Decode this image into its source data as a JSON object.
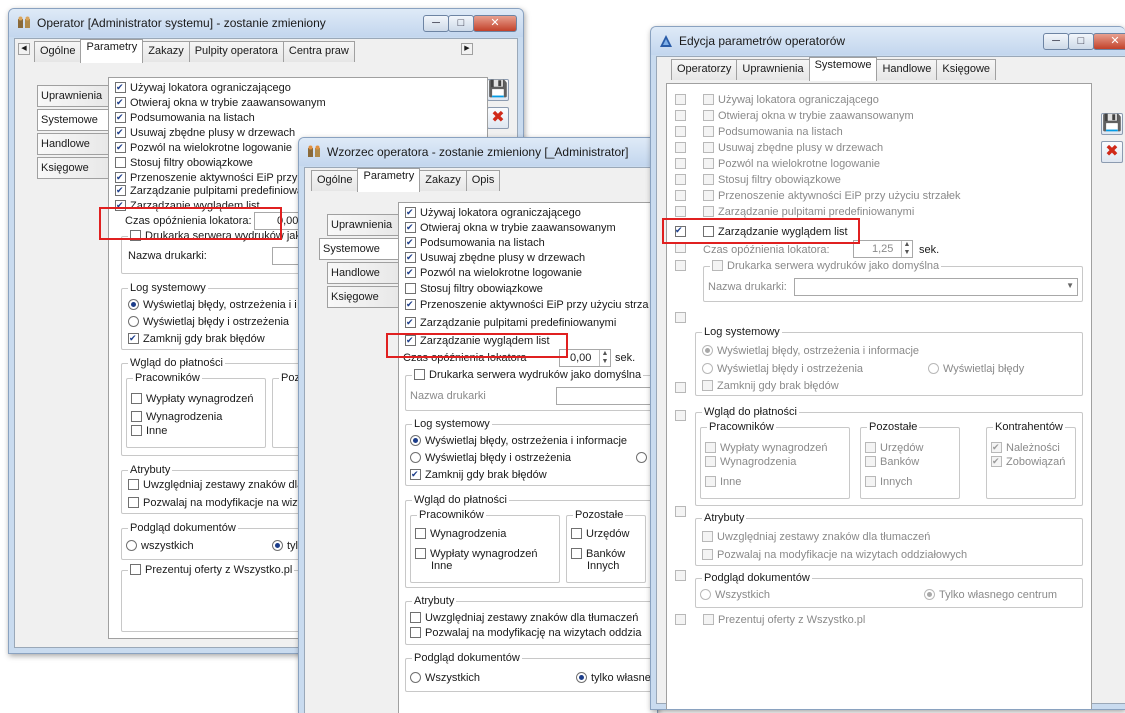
{
  "colors": {
    "highlight": "#e02020",
    "title_gradient_top": "#dfeaf7",
    "checkbox_mark": "#1c3d8a"
  },
  "win1": {
    "title": "Operator [Administrator systemu] - zostanie zmieniony",
    "tabs": [
      "Ogólne",
      "Parametry",
      "Zakazy",
      "Pulpity operatora",
      "Centra praw"
    ],
    "vtabs": [
      "Uprawnienia",
      "Systemowe",
      "Handlowe",
      "Księgowe"
    ],
    "checks": [
      "Używaj lokatora ograniczającego",
      "Otwieraj okna w trybie zaawansowanym",
      "Podsumowania na listach",
      "Usuwaj zbędne plusy w drzewach",
      "Pozwól na wielokrotne logowanie",
      "Stosuj filtry obowiązkowe",
      "Przenoszenie aktywności EiP przy",
      "Zarządzanie pulpitami predefiniowanymi",
      "Zarządzanie wyglądem list"
    ],
    "lokator_label": "Czas opóźnienia lokatora:",
    "lokator_value": "0,00",
    "printer_check": "Drukarka serwera wydruków jako",
    "printer_label": "Nazwa drukarki:",
    "log_group": "Log systemowy",
    "log_opts": [
      "Wyświetlaj błędy, ostrzeżenia i i",
      "Wyświetlaj błędy i ostrzeżenia"
    ],
    "log_close": "Zamknij gdy brak błędów",
    "wglad_group": "Wgląd do płatności",
    "pracownikow": "Pracowników",
    "pozo": "Pozo",
    "pracownikow_items": [
      "Wypłaty wynagrodzeń",
      "Wynagrodzenia",
      "Inne"
    ],
    "atrybuty_group": "Atrybuty",
    "atrybuty_items": [
      "Uwzględniaj zestawy znaków dla",
      "Pozwalaj na modyfikacje na wizy"
    ],
    "podglad_group": "Podgląd dokumentów",
    "podglad_opts": [
      "wszystkich",
      "tyll"
    ],
    "prezentuj": "Prezentuj oferty z Wszystko.pl"
  },
  "win2": {
    "title": "Wzorzec operatora - zostanie zmieniony [_Administrator]",
    "tabs": [
      "Ogólne",
      "Parametry",
      "Zakazy",
      "Opis"
    ],
    "vtabs": [
      "Uprawnienia",
      "Systemowe",
      "Handlowe",
      "Księgowe"
    ],
    "checks": [
      "Używaj lokatora ograniczającego",
      "Otwieraj okna w trybie zaawansowanym",
      "Podsumowania na listach",
      "Usuwaj zbędne plusy w drzewach",
      "Pozwól na wielokrotne logowanie",
      "Stosuj filtry obowiązkowe",
      "Przenoszenie aktywności EiP przy użyciu strza",
      "Zarządzanie pulpitami predefiniowanymi",
      "Zarządzanie wyglądem list"
    ],
    "lokator_label": "Czas opóźnienia lokatora",
    "lokator_value": "0,00",
    "lokator_unit": "sek.",
    "printer_check": "Drukarka serwera wydruków jako domyślna",
    "printer_label": "Nazwa drukarki",
    "log_group": "Log systemowy",
    "log_opts": [
      "Wyświetlaj błędy, ostrzeżenia i informacje",
      "Wyświetlaj błędy i ostrzeżenia",
      "Wy"
    ],
    "log_close": "Zamknij gdy brak błędów",
    "wglad_group": "Wgląd do płatności",
    "pracownikow": "Pracowników",
    "pozostale": "Pozostałe",
    "pracownikow_items": [
      "Wynagrodzenia",
      "Wypłaty wynagrodzeń",
      "Inne"
    ],
    "pozostale_items": [
      "Urzędów",
      "Banków",
      "Innych"
    ],
    "atrybuty_group": "Atrybuty",
    "atrybuty_items": [
      "Uwzględniaj zestawy znaków dla tłumaczeń",
      "Pozwalaj na modyfikację na wizytach oddzia"
    ],
    "podglad_group": "Podgląd dokumentów",
    "podglad_opts": [
      "Wszystkich",
      "tylko własne"
    ]
  },
  "win3": {
    "title": "Edycja parametrów operatorów",
    "tabs": [
      "Operatorzy",
      "Uprawnienia",
      "Systemowe",
      "Handlowe",
      "Księgowe"
    ],
    "checks": [
      "Używaj lokatora ograniczającego",
      "Otwieraj okna w trybie zaawansowanym",
      "Podsumowania na listach",
      "Usuwaj zbędne plusy w drzewach",
      "Pozwól na wielokrotne logowanie",
      "Stosuj filtry obowiązkowe",
      "Przenoszenie aktywności EiP przy użyciu strzałek",
      "Zarządzanie pulpitami predefiniowanymi",
      "Zarządzanie wyglądem list"
    ],
    "lokator_label": "Czas opóźnienia lokatora:",
    "lokator_value": "1,25",
    "lokator_unit": "sek.",
    "printer_check": "Drukarka serwera wydruków jako domyślna",
    "printer_label": "Nazwa drukarki:",
    "log_group": "Log systemowy",
    "log_opts": [
      "Wyświetlaj błędy, ostrzeżenia i informacje",
      "Wyświetlaj błędy i ostrzeżenia",
      "Wyświetlaj błędy"
    ],
    "log_close": "Zamknij gdy brak błędów",
    "wglad_group": "Wgląd do płatności",
    "pracownikow": "Pracowników",
    "pozostale": "Pozostałe",
    "kontrahentow": "Kontrahentów",
    "pracownikow_items": [
      "Wypłaty wynagrodzeń",
      "Wynagrodzenia",
      "Inne"
    ],
    "pozostale_items": [
      "Urzędów",
      "Banków",
      "Innych"
    ],
    "kontrahentow_items": [
      "Należności",
      "Zobowiązań"
    ],
    "atrybuty_group": "Atrybuty",
    "atrybuty_items": [
      "Uwzględniaj zestawy znaków dla tłumaczeń",
      "Pozwalaj na modyfikacje na wizytach oddziałowych"
    ],
    "podglad_group": "Podgląd dokumentów",
    "podglad_opts": [
      "Wszystkich",
      "Tylko własnego centrum"
    ],
    "prezentuj": "Prezentuj oferty z Wszystko.pl"
  }
}
